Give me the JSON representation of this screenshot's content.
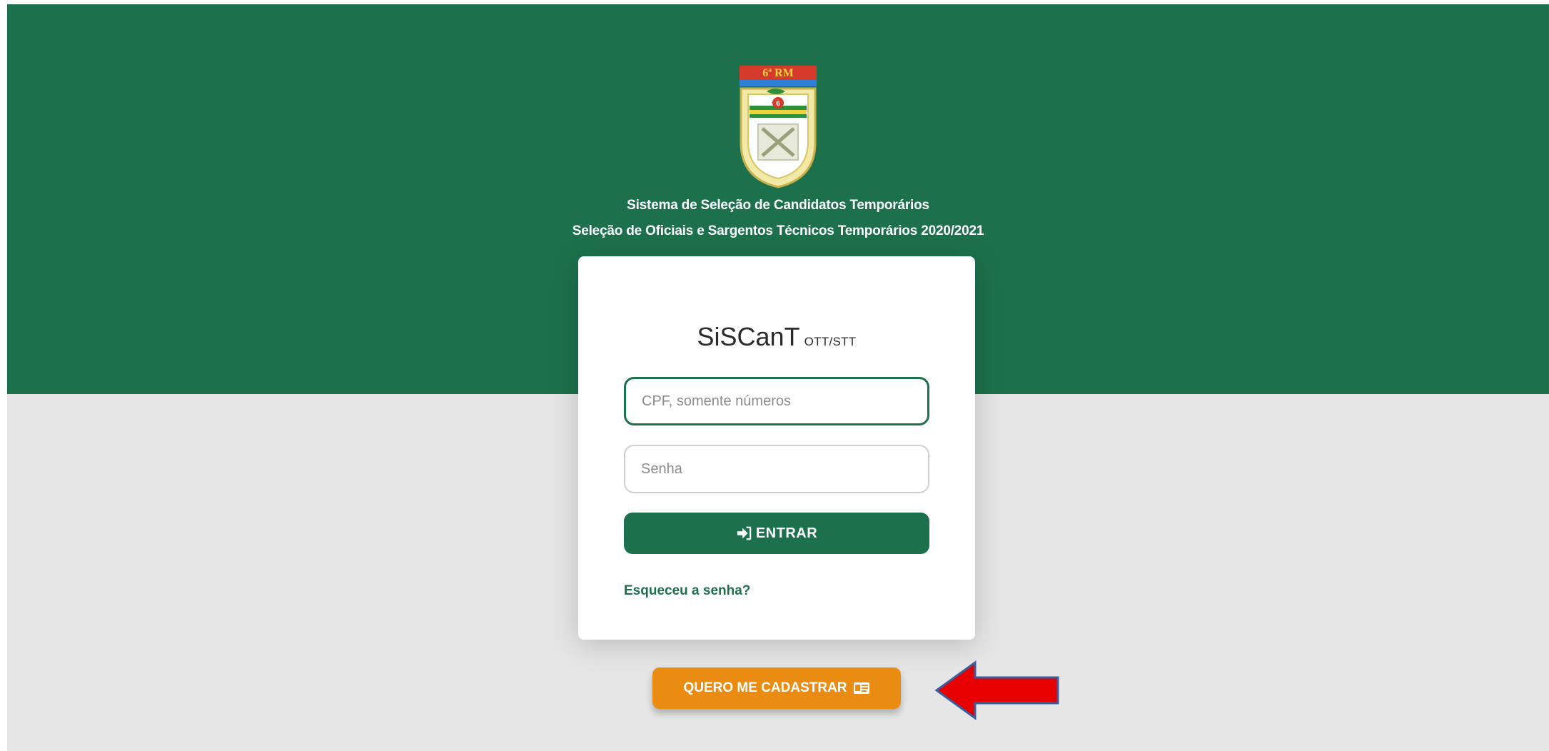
{
  "header": {
    "subtitle_line1": "Sistema de Seleção de Candidatos Temporários",
    "subtitle_line2": "Seleção de Oficiais e Sargentos Técnicos Temporários 2020/2021",
    "logo_text": "6ª RM",
    "logo_icon": "military-region-crest-icon"
  },
  "login": {
    "brand_main": "SiSCanT",
    "brand_suffix": "OTT/STT",
    "cpf_placeholder": "CPF, somente números",
    "cpf_value": "",
    "password_placeholder": "Senha",
    "password_value": "",
    "enter_label": "ENTRAR",
    "enter_icon": "sign-in-icon",
    "forgot_label": "Esqueceu a senha?"
  },
  "register": {
    "label": "QUERO ME CADASTRAR",
    "icon": "id-card-icon"
  },
  "annotation": {
    "arrow_icon": "red-arrow-left-icon"
  },
  "colors": {
    "primary_green": "#1c714c",
    "register_orange": "#ea8b12",
    "background_gray": "#e6e6e6",
    "arrow_red": "#e60000",
    "arrow_outline": "#3a5f9e"
  }
}
